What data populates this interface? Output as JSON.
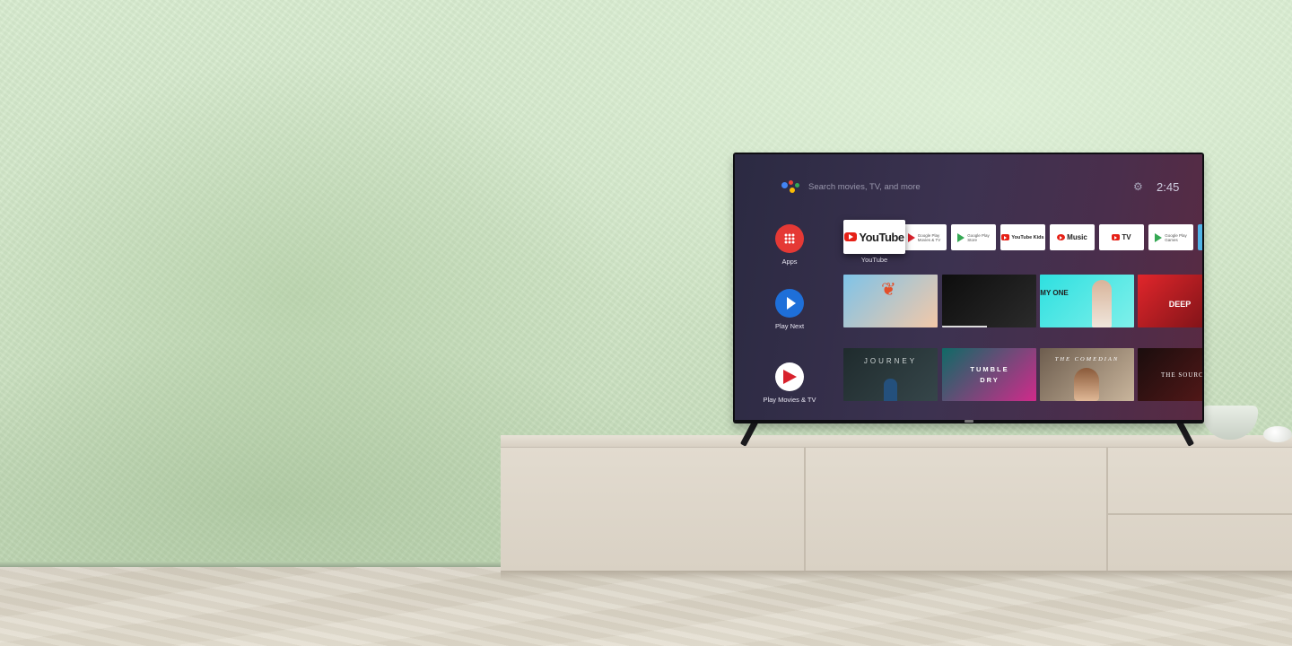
{
  "screen": {
    "search_placeholder": "Search movies, TV, and more",
    "clock": "2:45"
  },
  "rail": [
    {
      "label": "Apps"
    },
    {
      "label": "Play Next"
    },
    {
      "label": "Play Movies & TV"
    }
  ],
  "apps_row": {
    "focused": {
      "label": "YouTube",
      "caption": "YouTube"
    },
    "tiles": [
      {
        "line1": "Google Play",
        "line2": "Movies & TV"
      },
      {
        "line1": "Google Play",
        "line2": "Store"
      },
      {
        "label": "YouTube Kids"
      },
      {
        "label": "Music"
      },
      {
        "label": "TV"
      },
      {
        "line1": "Google Play",
        "line2": "Games"
      }
    ]
  },
  "play_next": [
    {
      "title": "",
      "colors": [
        "#7ec3e8",
        "#f3c8a8"
      ]
    },
    {
      "title": "",
      "colors": [
        "#0d0d0d",
        "#2b2b2b"
      ]
    },
    {
      "title": "MY ONE",
      "colors": [
        "#2ee0e0",
        "#7ff0ea"
      ]
    },
    {
      "title": "DEEP",
      "colors": [
        "#e1262b",
        "#6a0f14"
      ]
    }
  ],
  "movies_row": [
    {
      "title": "JOURNEY",
      "colors": [
        "#1f2b2d",
        "#36464a"
      ]
    },
    {
      "title": "TUMBLE DRY",
      "colors": [
        "#0f6a66",
        "#d12a8b"
      ]
    },
    {
      "title": "THE COMEDIAN",
      "colors": [
        "#6d5d4e",
        "#c9b59c"
      ]
    },
    {
      "title": "THE SOURCE",
      "colors": [
        "#1a0d0d",
        "#5e1a1a"
      ]
    }
  ],
  "colors": {
    "assistant": [
      "#4285f4",
      "#ea4335",
      "#fbbc05",
      "#34a853"
    ],
    "apps_accent": "#e53935",
    "play_next_accent": "#1e6fd9"
  }
}
